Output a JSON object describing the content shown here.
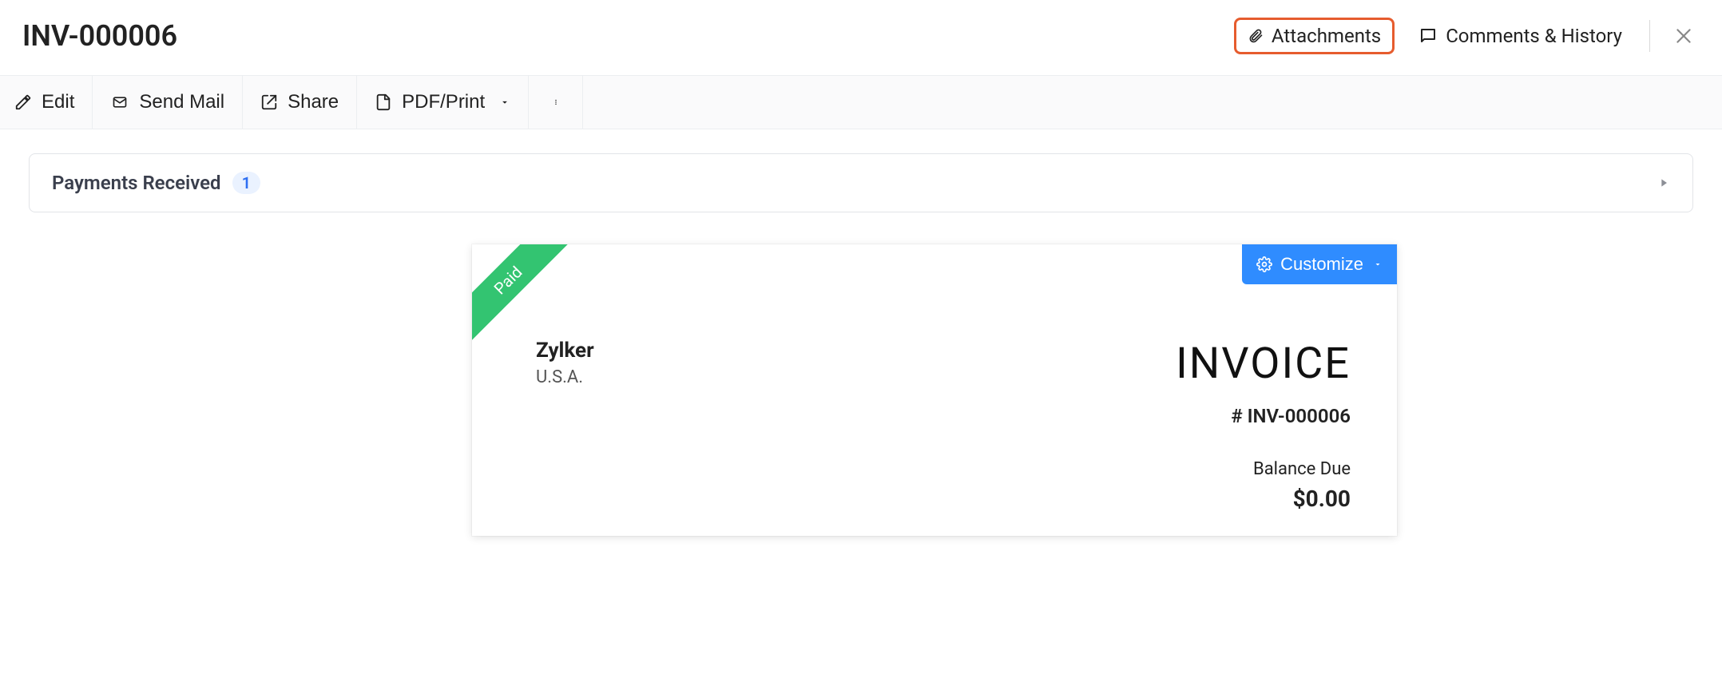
{
  "header": {
    "title": "INV-000006",
    "attachments_label": "Attachments",
    "comments_label": "Comments & History"
  },
  "toolbar": {
    "edit_label": "Edit",
    "send_mail_label": "Send Mail",
    "share_label": "Share",
    "pdf_print_label": "PDF/Print"
  },
  "payments": {
    "title": "Payments Received",
    "count": "1"
  },
  "invoice": {
    "ribbon_text": "Paid",
    "customize_label": "Customize",
    "company_name": "Zylker",
    "company_address": "U.S.A.",
    "doc_type": "INVOICE",
    "doc_number": "# INV-000006",
    "balance_label": "Balance Due",
    "balance_amount": "$0.00"
  }
}
